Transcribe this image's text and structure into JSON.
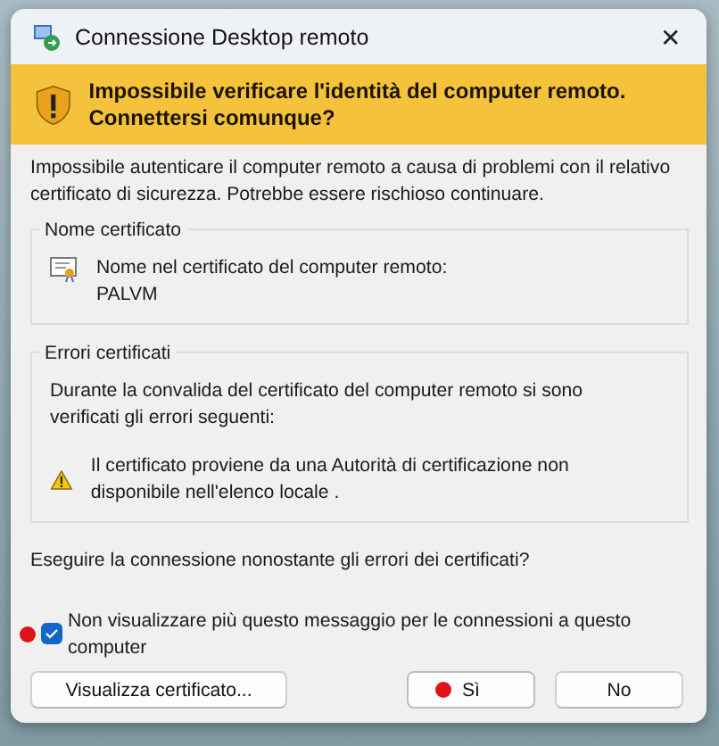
{
  "window": {
    "title": "Connessione Desktop remoto",
    "close": "✕"
  },
  "banner": {
    "title": "Impossibile verificare l'identità del computer remoto. Connettersi comunque?"
  },
  "message": "Impossibile autenticare il computer remoto a causa di problemi con il relativo certificato di sicurezza. Potrebbe essere rischioso continuare.",
  "certificate_name": {
    "legend": "Nome certificato",
    "label": "Nome nel certificato del computer remoto:",
    "value": "PALVM"
  },
  "certificate_errors": {
    "legend": "Errori certificati",
    "intro": "Durante la convalida del certificato del computer remoto si sono verificati gli errori seguenti:",
    "errors": [
      "Il certificato proviene da una Autorità di certificazione non disponibile nell'elenco locale ."
    ]
  },
  "question": "Eseguire la connessione nonostante gli errori dei certificati?",
  "dont_show": {
    "label": "Non visualizzare più questo messaggio per le connessioni a questo computer",
    "checked": true
  },
  "buttons": [
    {
      "kind": "secondary",
      "label": "Visualizza certificato..."
    },
    {
      "kind": "primary",
      "label": "Sì"
    },
    {
      "kind": "secondary",
      "label": "No"
    }
  ]
}
